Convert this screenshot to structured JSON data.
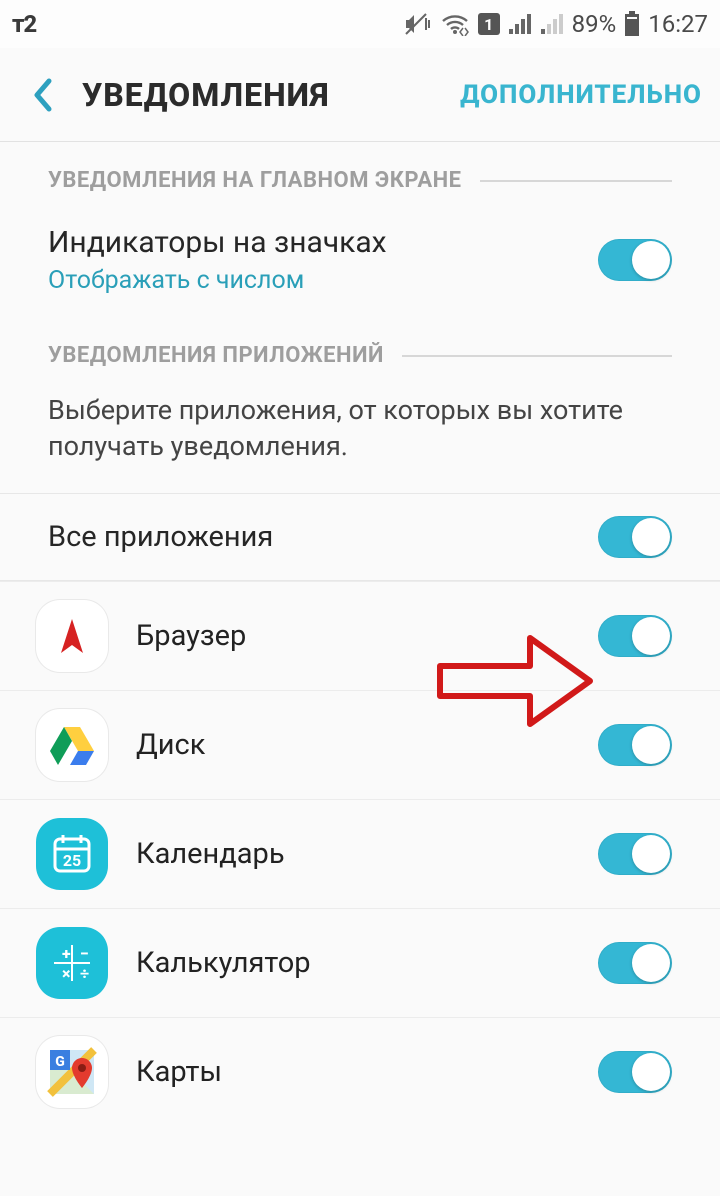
{
  "status": {
    "carrier": "т2",
    "battery_pct": "89%",
    "time": "16:27",
    "sim_slot": "1"
  },
  "appbar": {
    "title": "УВЕДОМЛЕНИЯ",
    "action": "ДОПОЛНИТЕЛЬНО"
  },
  "sections": {
    "lockscreen": {
      "header": "УВЕДОМЛЕНИЯ НА ГЛАВНОМ ЭКРАНЕ",
      "badge_title": "Индикаторы на значках",
      "badge_sub": "Отображать с числом"
    },
    "apps": {
      "header": "УВЕДОМЛЕНИЯ ПРИЛОЖЕНИЙ",
      "description": "Выберите приложения, от которых вы хотите получать уведомления.",
      "all_label": "Все приложения"
    }
  },
  "apps": [
    {
      "name": "Браузер",
      "icon": "yandex-browser-icon"
    },
    {
      "name": "Диск",
      "icon": "google-drive-icon"
    },
    {
      "name": "Календарь",
      "icon": "calendar-icon"
    },
    {
      "name": "Калькулятор",
      "icon": "calculator-icon"
    },
    {
      "name": "Карты",
      "icon": "google-maps-icon"
    }
  ]
}
